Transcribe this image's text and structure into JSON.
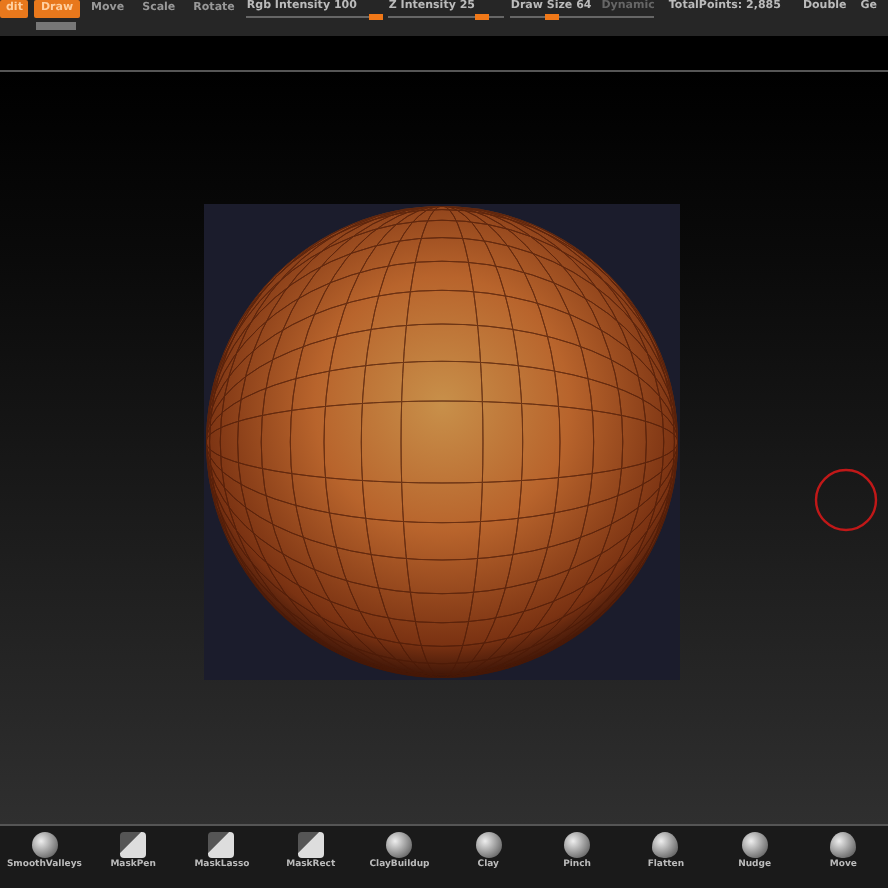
{
  "toolbar": {
    "modes": [
      {
        "label": "dit",
        "selected": true
      },
      {
        "label": "Draw",
        "selected": true
      },
      {
        "label": "Move",
        "selected": false
      },
      {
        "label": "Scale",
        "selected": false
      },
      {
        "label": "Rotate",
        "selected": false
      }
    ],
    "sliders": [
      {
        "label": "Rgb Intensity 100",
        "level": 0.95
      },
      {
        "label": "Z Intensity 25",
        "level": 0.8
      },
      {
        "label": "Draw Size 64",
        "level": 0.28,
        "extra": "Dynamic"
      }
    ],
    "total_points": "TotalPoints: 2,885",
    "double": "Double",
    "cut_label": "Ge"
  },
  "brushes": [
    {
      "label": "SmoothValleys",
      "kind": "sphere"
    },
    {
      "label": "MaskPen",
      "kind": "mask"
    },
    {
      "label": "MaskLasso",
      "kind": "mask"
    },
    {
      "label": "MaskRect",
      "kind": "mask"
    },
    {
      "label": "ClayBuildup",
      "kind": "sphere"
    },
    {
      "label": "Clay",
      "kind": "sphere"
    },
    {
      "label": "Pinch",
      "kind": "sphere"
    },
    {
      "label": "Flatten",
      "kind": "blob"
    },
    {
      "label": "Nudge",
      "kind": "sphere"
    },
    {
      "label": "Move",
      "kind": "blob"
    }
  ]
}
